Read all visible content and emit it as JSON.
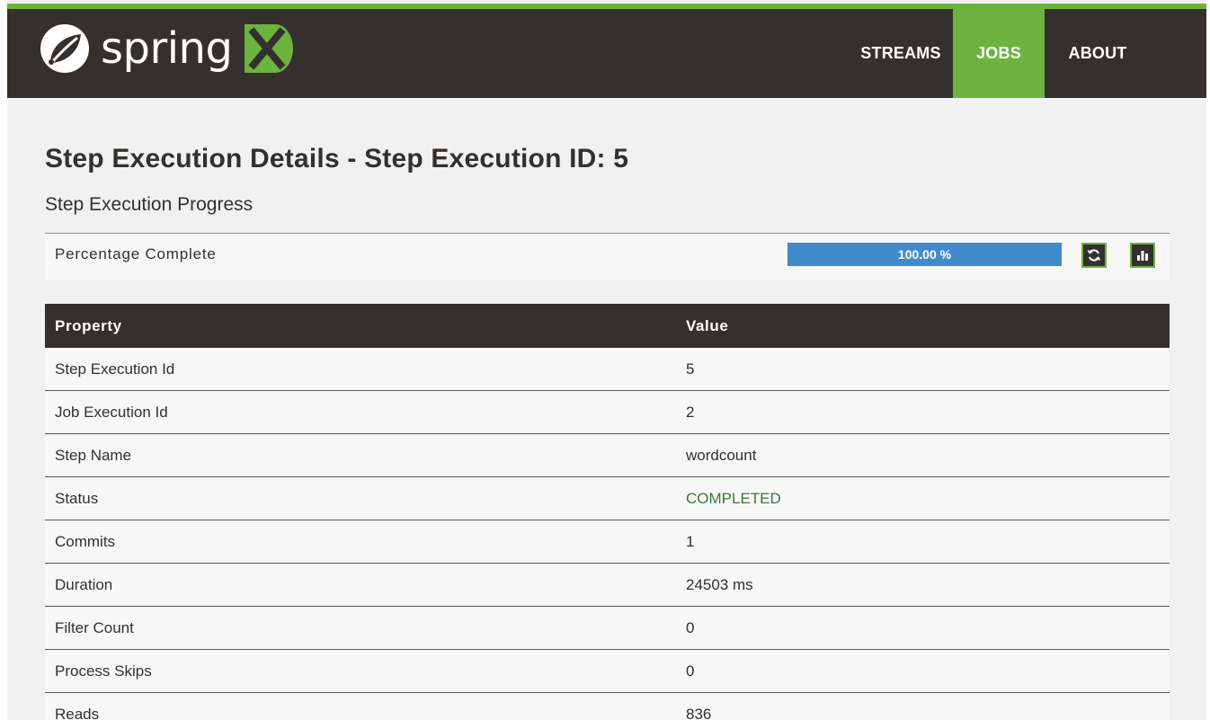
{
  "brand": {
    "logo_text": "spring",
    "colors": {
      "accent": "#6db33f",
      "dark": "#34302d",
      "progress": "#428bca",
      "status_completed": "#3c763d"
    }
  },
  "nav": {
    "items": [
      {
        "label": "STREAMS",
        "active": false
      },
      {
        "label": "JOBS",
        "active": true
      },
      {
        "label": "ABOUT",
        "active": false
      }
    ]
  },
  "page": {
    "title": "Step Execution Details - Step Execution ID: 5",
    "progress_heading": "Step Execution Progress",
    "progress": {
      "label": "Percentage Complete",
      "percent_text": "100.00 %",
      "percent": 100,
      "refresh_icon": "refresh-icon",
      "chart_icon": "bar-chart-icon"
    },
    "table": {
      "headers": [
        "Property",
        "Value"
      ],
      "rows": [
        {
          "property": "Step Execution Id",
          "value": "5"
        },
        {
          "property": "Job Execution Id",
          "value": "2"
        },
        {
          "property": "Step Name",
          "value": "wordcount"
        },
        {
          "property": "Status",
          "value": "COMPLETED"
        },
        {
          "property": "Commits",
          "value": "1"
        },
        {
          "property": "Duration",
          "value": "24503 ms"
        },
        {
          "property": "Filter Count",
          "value": "0"
        },
        {
          "property": "Process Skips",
          "value": "0"
        },
        {
          "property": "Reads",
          "value": "836"
        }
      ]
    }
  }
}
